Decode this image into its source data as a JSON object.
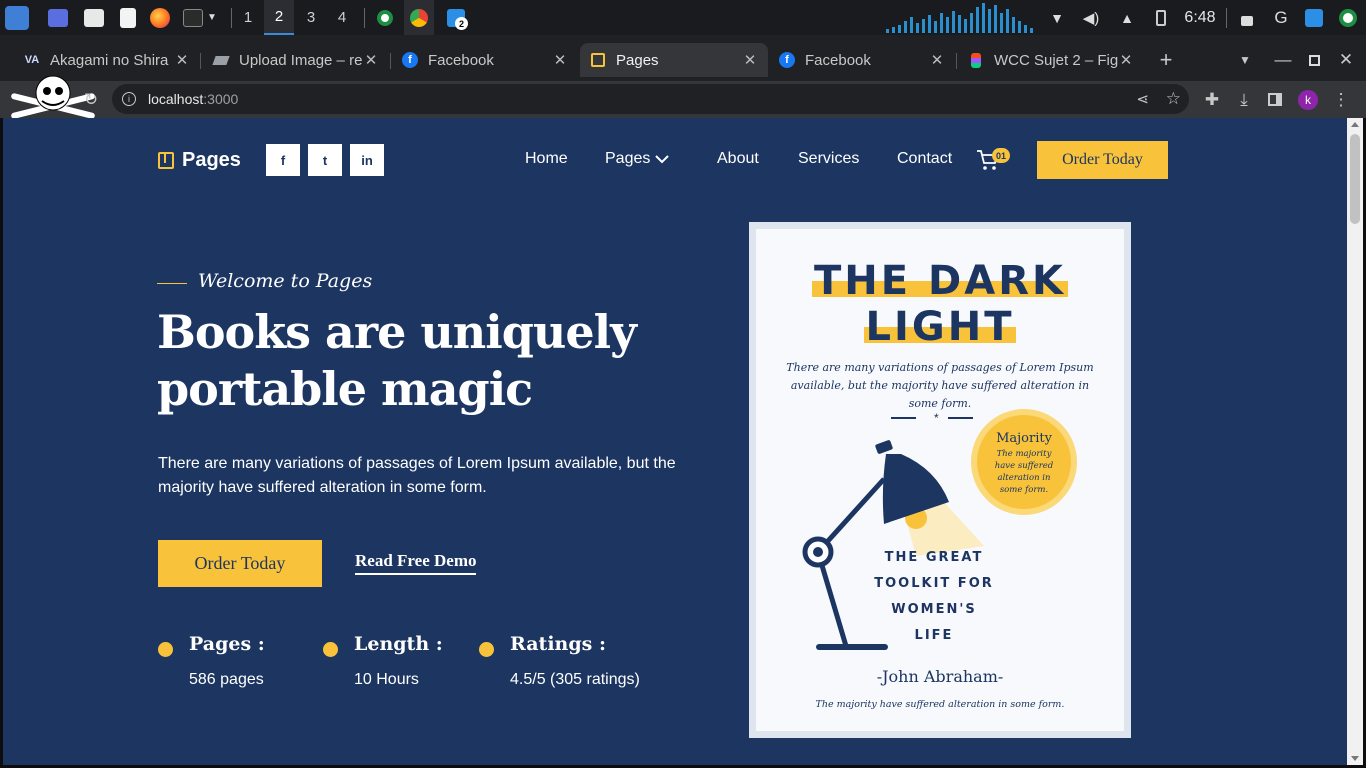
{
  "taskbar": {
    "workspaces": [
      "1",
      "2",
      "3",
      "4"
    ],
    "active_workspace": "2",
    "vscode_badge": "2",
    "clock": "6:48",
    "profile_letter": "k"
  },
  "browser": {
    "tabs": [
      {
        "title": "Akagami no Shira",
        "favicon": "VA"
      },
      {
        "title": "Upload Image – re",
        "favicon": "layers-icon"
      },
      {
        "title": "Facebook",
        "favicon": "f"
      },
      {
        "title": "Pages",
        "favicon": "book-icon",
        "active": true
      },
      {
        "title": "Facebook",
        "favicon": "f"
      },
      {
        "title": "WCC Sujet 2 – Fig",
        "favicon": "figma-icon"
      }
    ],
    "url_host": "localhost",
    "url_port": ":3000"
  },
  "site": {
    "logo_text": "Pages",
    "social": [
      "f",
      "t",
      "in"
    ],
    "nav": [
      "Home",
      "Pages",
      "About",
      "Services",
      "Contact"
    ],
    "cart_count": "01",
    "order_button": "Order Today"
  },
  "hero": {
    "welcome": "Welcome to Pages",
    "headline_line1": "Books are uniquely",
    "headline_line2": "portable magic",
    "description": "There are many variations of passages of Lorem Ipsum available, but the majority have suffered alteration in some form.",
    "order_button": "Order Today",
    "demo_link": "Read Free Demo",
    "stats": [
      {
        "label": "Pages :",
        "value": "586 pages"
      },
      {
        "label": "Length :",
        "value": "10 Hours"
      },
      {
        "label": "Ratings :",
        "value": "4.5/5 (305 ratings)"
      }
    ]
  },
  "book": {
    "title_line1": "THE DARK",
    "title_line2": "LIGHT",
    "blurb": "There are many variations of passages of Lorem Ipsum available, but the majority have suffered alteration in some form.",
    "divider_mark": "*",
    "badge_title": "Majority",
    "badge_text": "The majority have suffered alteration in some form.",
    "subtitle_lines": [
      "THE GREAT",
      "TOOLKIT FOR",
      "WOMEN'S",
      "LIFE"
    ],
    "author": "-John Abraham-",
    "footer": "The majority have suffered alteration in some form."
  },
  "colors": {
    "page_bg": "#1c3561",
    "accent": "#f8c33a",
    "book_bg": "#f7f9fc"
  }
}
